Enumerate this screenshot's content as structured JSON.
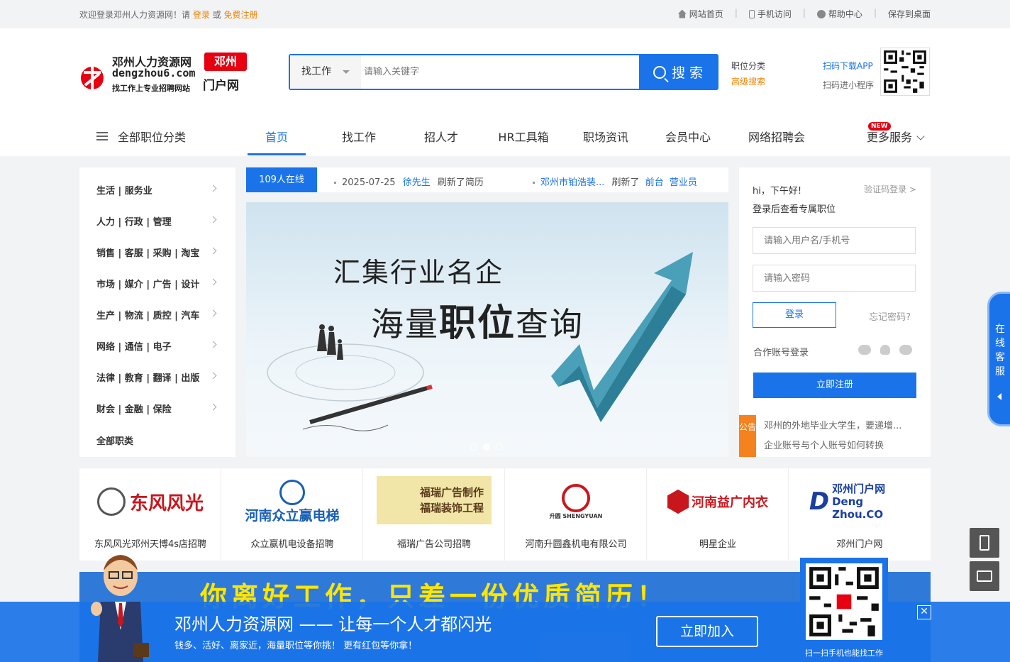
{
  "topbar": {
    "welcome_prefix": "欢迎登录邓州人力资源网！请",
    "login": "登录",
    "or": "或",
    "register": "免费注册",
    "links": [
      "网站首页",
      "手机访问",
      "帮助中心",
      "保存到桌面"
    ]
  },
  "logo": {
    "title": "邓州人力资源网",
    "domain": "dengzhou6.com",
    "slogan": "找工作上专业招聘网站",
    "city": "邓州",
    "portal": "门户网"
  },
  "search": {
    "type_label": "找工作",
    "placeholder": "请输入关键字",
    "button": "搜 索",
    "link_category": "职位分类",
    "link_advanced": "高级搜索",
    "app_download": "扫码下载APP",
    "mini_program": "扫码进小程序"
  },
  "nav": {
    "all_categories": "全部职位分类",
    "items": [
      "首页",
      "找工作",
      "招人才",
      "HR工具箱",
      "职场资讯",
      "会员中心",
      "网络招聘会",
      "更多服务"
    ],
    "active": "首页",
    "new_badge": "NEW"
  },
  "categories": [
    "生活 | 服务业",
    "人力 | 行政 | 管理",
    "销售 | 客服 | 采购 | 淘宝",
    "市场 | 媒介 | 广告 | 设计",
    "生产 | 物流 | 质控 | 汽车",
    "网络 | 通信 | 电子",
    "法律 | 教育 | 翻译 | 出版",
    "财会 | 金融 | 保险",
    "全部职类"
  ],
  "online": {
    "count_label": "109人在线",
    "ticker1_date": "2025-07-25",
    "ticker1_name": "徐先生",
    "ticker1_action": "刷新了简历",
    "ticker2_company": "邓州市铂浩装...",
    "ticker2_action": "刷新了",
    "ticker2_job1": "前台",
    "ticker2_job2": "营业员"
  },
  "banner": {
    "line1": "汇集行业名企",
    "line2_pre": "海量",
    "line2_bold": "职位",
    "line2_post": "查询",
    "slides": 3,
    "active_slide": 2
  },
  "login": {
    "greeting": "hi，下午好!",
    "sms_login": "验证码登录 >",
    "subtitle": "登录后查看专属职位",
    "username_placeholder": "请输入用户名/手机号",
    "password_placeholder": "请输入密码",
    "login_button": "登录",
    "forgot": "忘记密码?",
    "partner_login": "合作账号登录",
    "register_button": "立即注册",
    "notice_tag": "公告",
    "notice1": "邓州的外地毕业大学生，要递增...",
    "notice2": "企业账号与个人账号如何转换"
  },
  "kefu": {
    "label": "在线客服"
  },
  "companies": [
    {
      "logo_text": "东风风光",
      "name": "东风风光邓州天博4s店招聘",
      "color": "#c8161d"
    },
    {
      "logo_text": "河南众立赢电梯",
      "name": "众立赢机电设备招聘",
      "color": "#1a5fb4"
    },
    {
      "logo_text": "福瑞广告制作 福瑞装饰工程",
      "name": "福瑞广告公司招聘",
      "color": "#5a3a1a"
    },
    {
      "logo_text": "升圆 SHENGYUAN",
      "name": "河南升圆鑫机电有限公司",
      "color": "#c8161d"
    },
    {
      "logo_text": "河南益广内衣",
      "name": "明星企业",
      "color": "#c8161d"
    },
    {
      "logo_text": "邓州门户网 Deng Zhou.CO",
      "name": "邓州门户网",
      "color": "#1a3fa0"
    }
  ],
  "bottom_banner": {
    "headline": "你离好工作，只差一份优质简历！"
  },
  "floatbar": {
    "title": "邓州人力资源网 —— 让每一个人才都闪光",
    "subtitle": "钱多、活好、离家近，海量职位等你挑！ 更有红包等你拿！",
    "join": "立即加入",
    "close": "✕",
    "qr_caption": "扫一扫手机也能找工作"
  }
}
